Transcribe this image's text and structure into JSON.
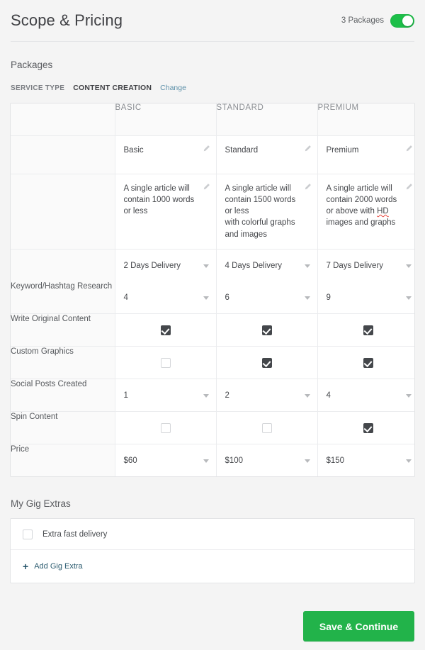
{
  "header": {
    "title": "Scope & Pricing",
    "toggle_label": "3 Packages",
    "toggle_on": true,
    "toggle_color": "#1dbf49"
  },
  "packages": {
    "section_title": "Packages",
    "service_type_key": "SERVICE TYPE",
    "service_type_value": "CONTENT CREATION",
    "change_label": "Change",
    "change_color": "#5b8fa8",
    "columns": [
      {
        "header": "BASIC"
      },
      {
        "header": "STANDARD"
      },
      {
        "header": "PREMIUM"
      }
    ],
    "name_row": {
      "values": [
        "Basic",
        "Standard",
        "Premium"
      ],
      "icon": "pencil-icon"
    },
    "description_row": {
      "values": [
        "A single article will contain 1000 words or less",
        "A single article will contain  1500 words or less\nwith colorful graphs and images",
        "A single article will contain 2000 words or above with HD images and graphs"
      ],
      "misspelled": "HD",
      "icon": "pencil-icon"
    },
    "delivery_row": {
      "values": [
        "2 Days Delivery",
        "4 Days Delivery",
        "7 Days Delivery"
      ]
    },
    "feature_rows": [
      {
        "label": "Keyword/Hashtag Research",
        "type": "select",
        "values": [
          "4",
          "6",
          "9"
        ]
      },
      {
        "label": "Write Original Content",
        "type": "checkbox",
        "values": [
          true,
          true,
          true
        ]
      },
      {
        "label": "Custom Graphics",
        "type": "checkbox",
        "values": [
          false,
          true,
          true
        ]
      },
      {
        "label": "Social Posts Created",
        "type": "select",
        "values": [
          "1",
          "2",
          "4"
        ]
      },
      {
        "label": "Spin Content",
        "type": "checkbox",
        "values": [
          false,
          false,
          true
        ]
      },
      {
        "label": "Price",
        "type": "select",
        "values": [
          "$60",
          "$100",
          "$150"
        ]
      }
    ]
  },
  "gig_extras": {
    "title": "My Gig Extras",
    "items": [
      {
        "label": "Extra fast delivery",
        "checked": false
      }
    ],
    "add_label": "Add Gig Extra",
    "add_icon": "plus-icon"
  },
  "footer": {
    "save_label": "Save & Continue",
    "save_color": "#22b34a"
  }
}
